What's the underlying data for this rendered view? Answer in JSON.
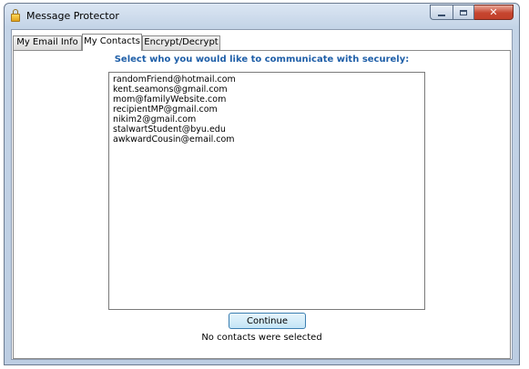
{
  "window": {
    "title": "Message Protector"
  },
  "window_controls": {
    "close_glyph": "✕"
  },
  "tabs": [
    {
      "label": "My Email Info",
      "active": false
    },
    {
      "label": "My Contacts",
      "active": true
    },
    {
      "label": "Encrypt/Decrypt",
      "active": false
    }
  ],
  "contacts": {
    "heading": "Select who you would like to communicate with securely:",
    "items": [
      "randomFriend@hotmail.com",
      "kent.seamons@gmail.com",
      "mom@familyWebsite.com",
      "recipientMP@gmail.com",
      "nikim2@gmail.com",
      "stalwartStudent@byu.edu",
      "awkwardCousin@email.com"
    ],
    "continue_label": "Continue",
    "status": "No contacts were selected"
  }
}
